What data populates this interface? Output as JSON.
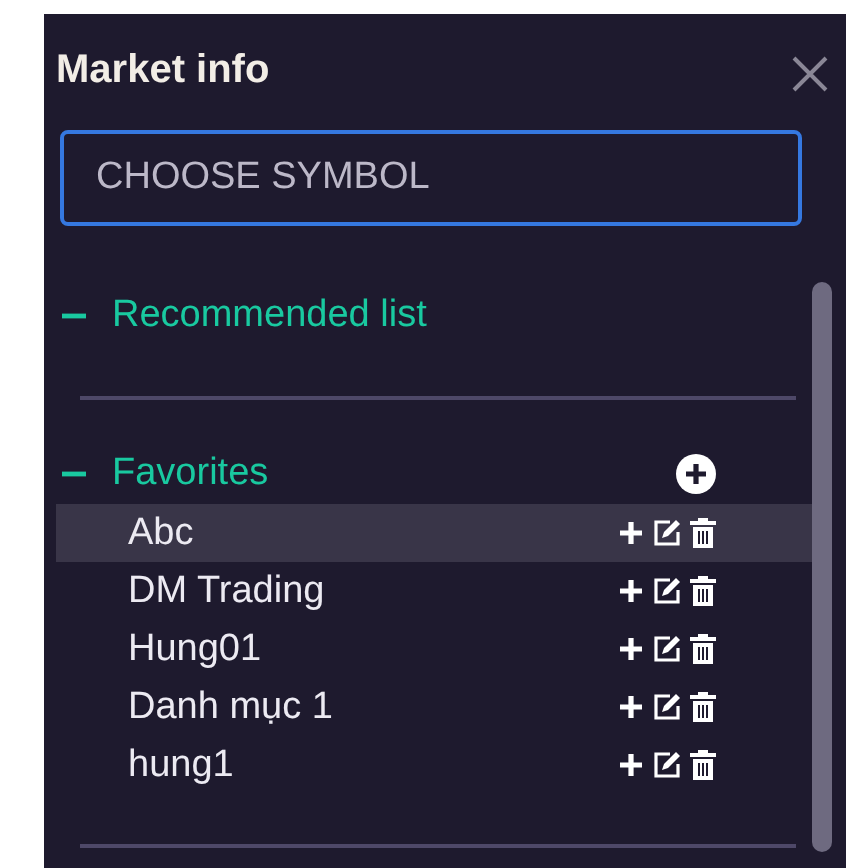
{
  "panel": {
    "title": "Market info"
  },
  "search": {
    "placeholder": "CHOOSE SYMBOL"
  },
  "sections": [
    {
      "label": "Recommended list",
      "expanded": true,
      "can_add": false
    },
    {
      "label": "Favorites",
      "expanded": true,
      "can_add": true,
      "items": [
        {
          "name": "Abc",
          "selected": true
        },
        {
          "name": "DM Trading",
          "selected": false
        },
        {
          "name": "Hung01",
          "selected": false
        },
        {
          "name": "Danh mục 1",
          "selected": false
        },
        {
          "name": "hung1",
          "selected": false
        }
      ]
    }
  ]
}
